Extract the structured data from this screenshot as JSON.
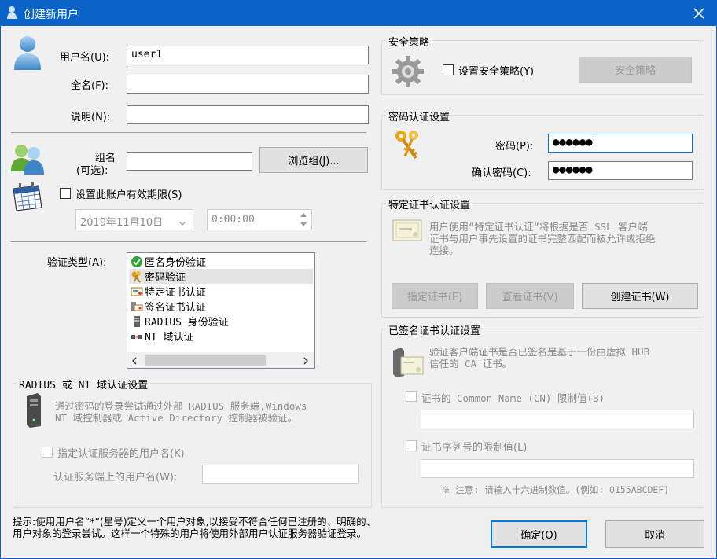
{
  "window": {
    "title": "创建新用户"
  },
  "user": {
    "username_label": "用户名(U):",
    "username_value": "user1",
    "fullname_label": "全名(F):",
    "fullname_value": "",
    "desc_label": "说明(N):",
    "desc_value": ""
  },
  "group": {
    "label_line1": "组名",
    "label_line2": "(可选):",
    "value": "",
    "browse_button": "浏览组(J)..."
  },
  "expiry": {
    "checkbox_label": "设置此账户有效期限(S)",
    "date_value": "2019年11月10日",
    "time_value": "0:00:00"
  },
  "auth_type": {
    "label": "验证类型(A):",
    "items": [
      {
        "label": "匿名身份验证"
      },
      {
        "label": "密码验证"
      },
      {
        "label": "特定证书认证"
      },
      {
        "label": "签名证书认证"
      },
      {
        "label": "RADIUS 身份验证"
      },
      {
        "label": "NT 域认证"
      }
    ]
  },
  "radius": {
    "title": "RADIUS 或 NT 域认证设置",
    "desc_line1": "通过密码的登录尝试通过外部 RADIUS 服务端,Windows",
    "desc_line2": "NT 域控制器或 Active Directory 控制器被验证。",
    "checkbox_label": "指定认证服务器的用户名(K)",
    "server_user_label": "认证服务端上的用户名(W):",
    "server_user_value": ""
  },
  "hint": {
    "line1": "提示:使用用户名“*”(星号)定义一个用户对象,以接受不符合任何已注册的、明确的、",
    "line2": "用户对象的登录尝试。这样一个特殊的用户将使用外部用户认证服务器验证登录。"
  },
  "security": {
    "title": "安全策略",
    "checkbox_label": "设置安全策略(Y)",
    "button": "安全策略"
  },
  "password": {
    "title": "密码认证设置",
    "pw_label": "密码(P):",
    "pw_value": "●●●●●●",
    "confirm_label": "确认密码(C):",
    "confirm_value": "●●●●●●"
  },
  "cert": {
    "title": "特定证书认证设置",
    "desc_line1": "用户使用“特定证书认证”将根据是否 SSL 客户端",
    "desc_line2": "证书与用户事先设置的证书完整匹配而被允许或拒绝",
    "desc_line3": "连接。",
    "specify_button": "指定证书(E)",
    "view_button": "查看证书(V)",
    "create_button": "创建证书(W)"
  },
  "signed": {
    "title": "已签名证书认证设置",
    "desc_line1": "验证客户端证书是否已签名是基于一份由虚拟 HUB",
    "desc_line2": "信任的 CA 证书。",
    "cn_label": "证书的 Common Name (CN) 限制值(B)",
    "cn_value": "",
    "serial_label": "证书序列号的限制值(L)",
    "serial_value": "",
    "note": "※ 注意: 请输入十六进制数值。(例如: 0155ABCDEF)"
  },
  "footer": {
    "ok_button": "确定(O)",
    "cancel_button": "取消"
  }
}
